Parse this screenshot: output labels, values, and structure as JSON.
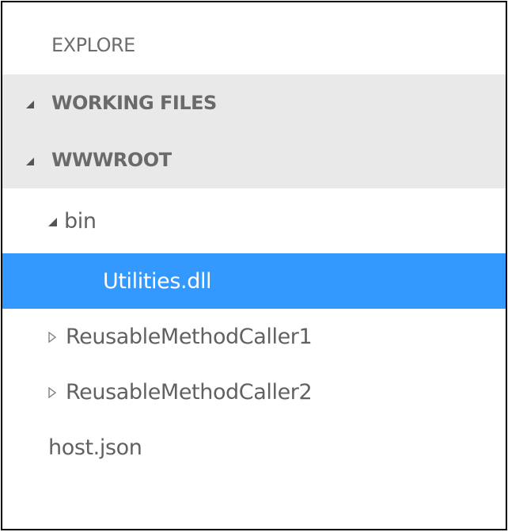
{
  "explorer": {
    "title": "EXPLORE",
    "sections": [
      {
        "label": "WORKING FILES",
        "icon": "triangle-expanded-icon"
      },
      {
        "label": "WWWROOT",
        "icon": "triangle-expanded-icon"
      }
    ],
    "tree": [
      {
        "label": "bin",
        "type": "folder",
        "state": "expanded",
        "icon": "triangle-expanded-icon"
      },
      {
        "label": "Utilities.dll",
        "type": "file",
        "state": "selected"
      },
      {
        "label": "ReusableMethodCaller1",
        "type": "folder",
        "state": "collapsed",
        "icon": "triangle-collapsed-icon"
      },
      {
        "label": "ReusableMethodCaller2",
        "type": "folder",
        "state": "collapsed",
        "icon": "triangle-collapsed-icon"
      },
      {
        "label": "host.json",
        "type": "file",
        "state": "normal"
      }
    ]
  },
  "colors": {
    "selection": "#3399ff",
    "section_background": "#e9e9e9",
    "text": "#616161"
  }
}
